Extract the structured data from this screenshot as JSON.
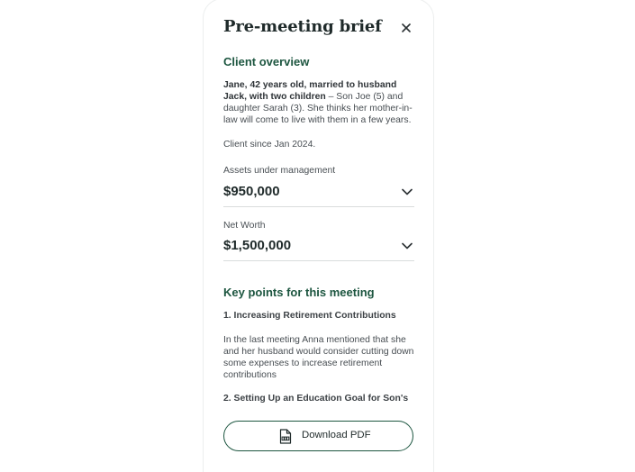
{
  "brief": {
    "title": "Pre-meeting brief",
    "close_icon": "close-icon",
    "client_overview": {
      "heading": "Client overview",
      "summary_bold": "Jane, 42 years old, married to husband Jack, with two children",
      "summary_rest": " – Son Joe (5) and daughter Sarah (3). She thinks her mother-in-law will come to live with them in a few years.",
      "client_since": "Client since Jan 2024."
    },
    "assets": {
      "label": "Assets under management",
      "value": "$950,000",
      "icon": "chevron-down-icon"
    },
    "net_worth": {
      "label": "Net Worth",
      "value": "$1,500,000",
      "icon": "chevron-down-icon"
    },
    "key_points": {
      "heading": "Key points for this meeting",
      "items": [
        {
          "title": "1. Increasing Retirement Contributions",
          "body": "In the last meeting Anna mentioned that she and her husband would consider cutting down some expenses to increase retirement contributions"
        },
        {
          "title": "2. Setting Up an Education Goal for Son's"
        }
      ]
    },
    "download": {
      "label": "Download PDF",
      "icon": "pdf-file-icon"
    }
  },
  "colors": {
    "accent": "#1d5640",
    "text": "#474d52",
    "divider": "#d9dcdc"
  }
}
